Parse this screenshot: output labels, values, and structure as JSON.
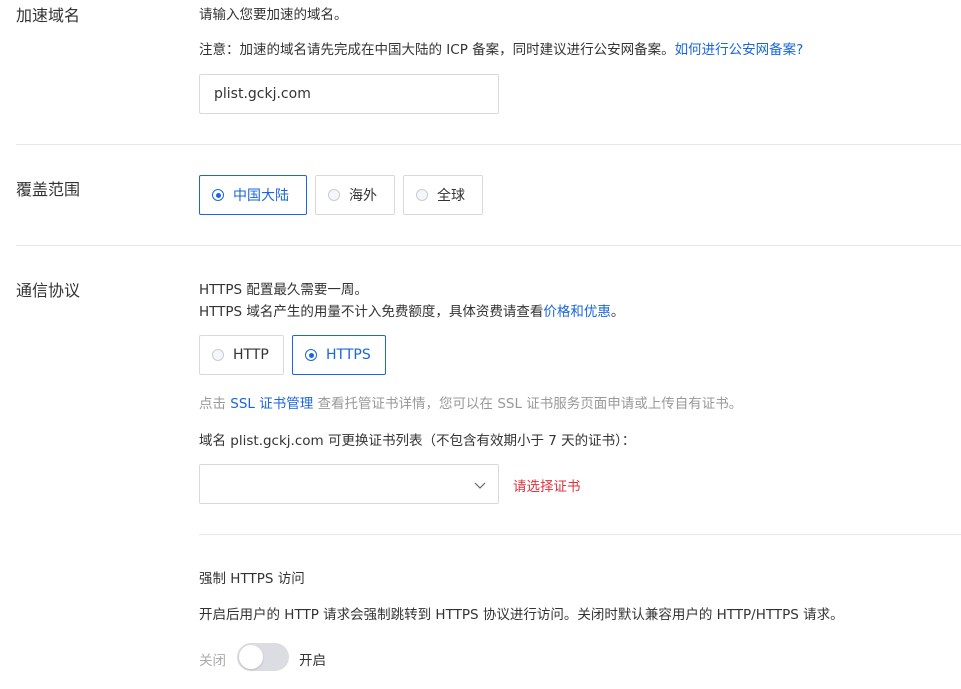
{
  "domain": {
    "label": "加速域名",
    "hint": "请输入您要加速的域名。",
    "notice_prefix": "注意：加速的域名请先完成在中国大陆的 ICP 备案，同时建议进行公安网备案。",
    "notice_link": "如何进行公安网备案?",
    "input_value": "plist.gckj.com"
  },
  "coverage": {
    "label": "覆盖范围",
    "options": [
      {
        "label": "中国大陆",
        "selected": true
      },
      {
        "label": "海外",
        "selected": false
      },
      {
        "label": "全球",
        "selected": false
      }
    ]
  },
  "protocol": {
    "label": "通信协议",
    "line1": "HTTPS 配置最久需要一周。",
    "line2_prefix": "HTTPS 域名产生的用量不计入免费额度，具体资费请查看",
    "line2_link": "价格和优惠",
    "line2_suffix": "。",
    "options": [
      {
        "label": "HTTP",
        "selected": false
      },
      {
        "label": "HTTPS",
        "selected": true
      }
    ],
    "ssl_prefix": "点击 ",
    "ssl_link": "SSL 证书管理",
    "ssl_suffix": " 查看托管证书详情，您可以在 SSL 证书服务页面申请或上传自有证书。",
    "cert_list_title": "域名 plist.gckj.com 可更换证书列表（不包含有效期小于 7 天的证书）：",
    "cert_select_value": "",
    "cert_error": "请选择证书",
    "force_title": "强制 HTTPS 访问",
    "force_desc": "开启后用户的 HTTP 请求会强制跳转到 HTTPS 协议进行访问。关闭时默认兼容用户的 HTTP/HTTPS 请求。",
    "toggle_off_label": "关闭",
    "toggle_on_label": "开启",
    "toggle_on": false
  },
  "colors": {
    "accent": "#1a66e0",
    "error": "#e0303d",
    "muted": "#999999"
  }
}
